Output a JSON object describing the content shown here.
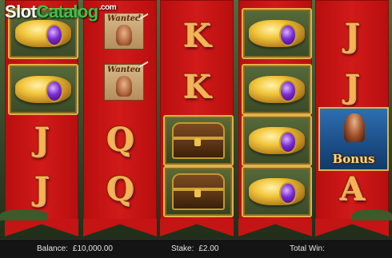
{
  "watermark": {
    "part1": "Slot",
    "part2": "Catalog",
    "suffix": ".com"
  },
  "reels": [
    {
      "symbols": [
        "ring",
        "ring",
        "J",
        "J"
      ]
    },
    {
      "symbols": [
        "wanted",
        "wanted",
        "Q",
        "Q"
      ]
    },
    {
      "symbols": [
        "K",
        "K",
        "chest",
        "chest"
      ]
    },
    {
      "symbols": [
        "ring",
        "ring",
        "ring",
        "ring"
      ]
    },
    {
      "symbols": [
        "J",
        "J",
        "bonus",
        "A"
      ]
    }
  ],
  "symbol_text": {
    "J": "J",
    "Q": "Q",
    "K": "K",
    "A": "A",
    "wanted": "Wanted",
    "bonus": "Bonus"
  },
  "info_bar": {
    "balance_label": "Balance:",
    "balance_value": "£10,000.00",
    "stake_label": "Stake:",
    "stake_value": "£2.00",
    "total_win_label": "Total Win:",
    "total_win_value": ""
  },
  "colors": {
    "reel_red": "#c41414",
    "gold": "#e0b24a",
    "letter_gold": "#f2b457",
    "bonus_blue": "#2d6fb2"
  }
}
